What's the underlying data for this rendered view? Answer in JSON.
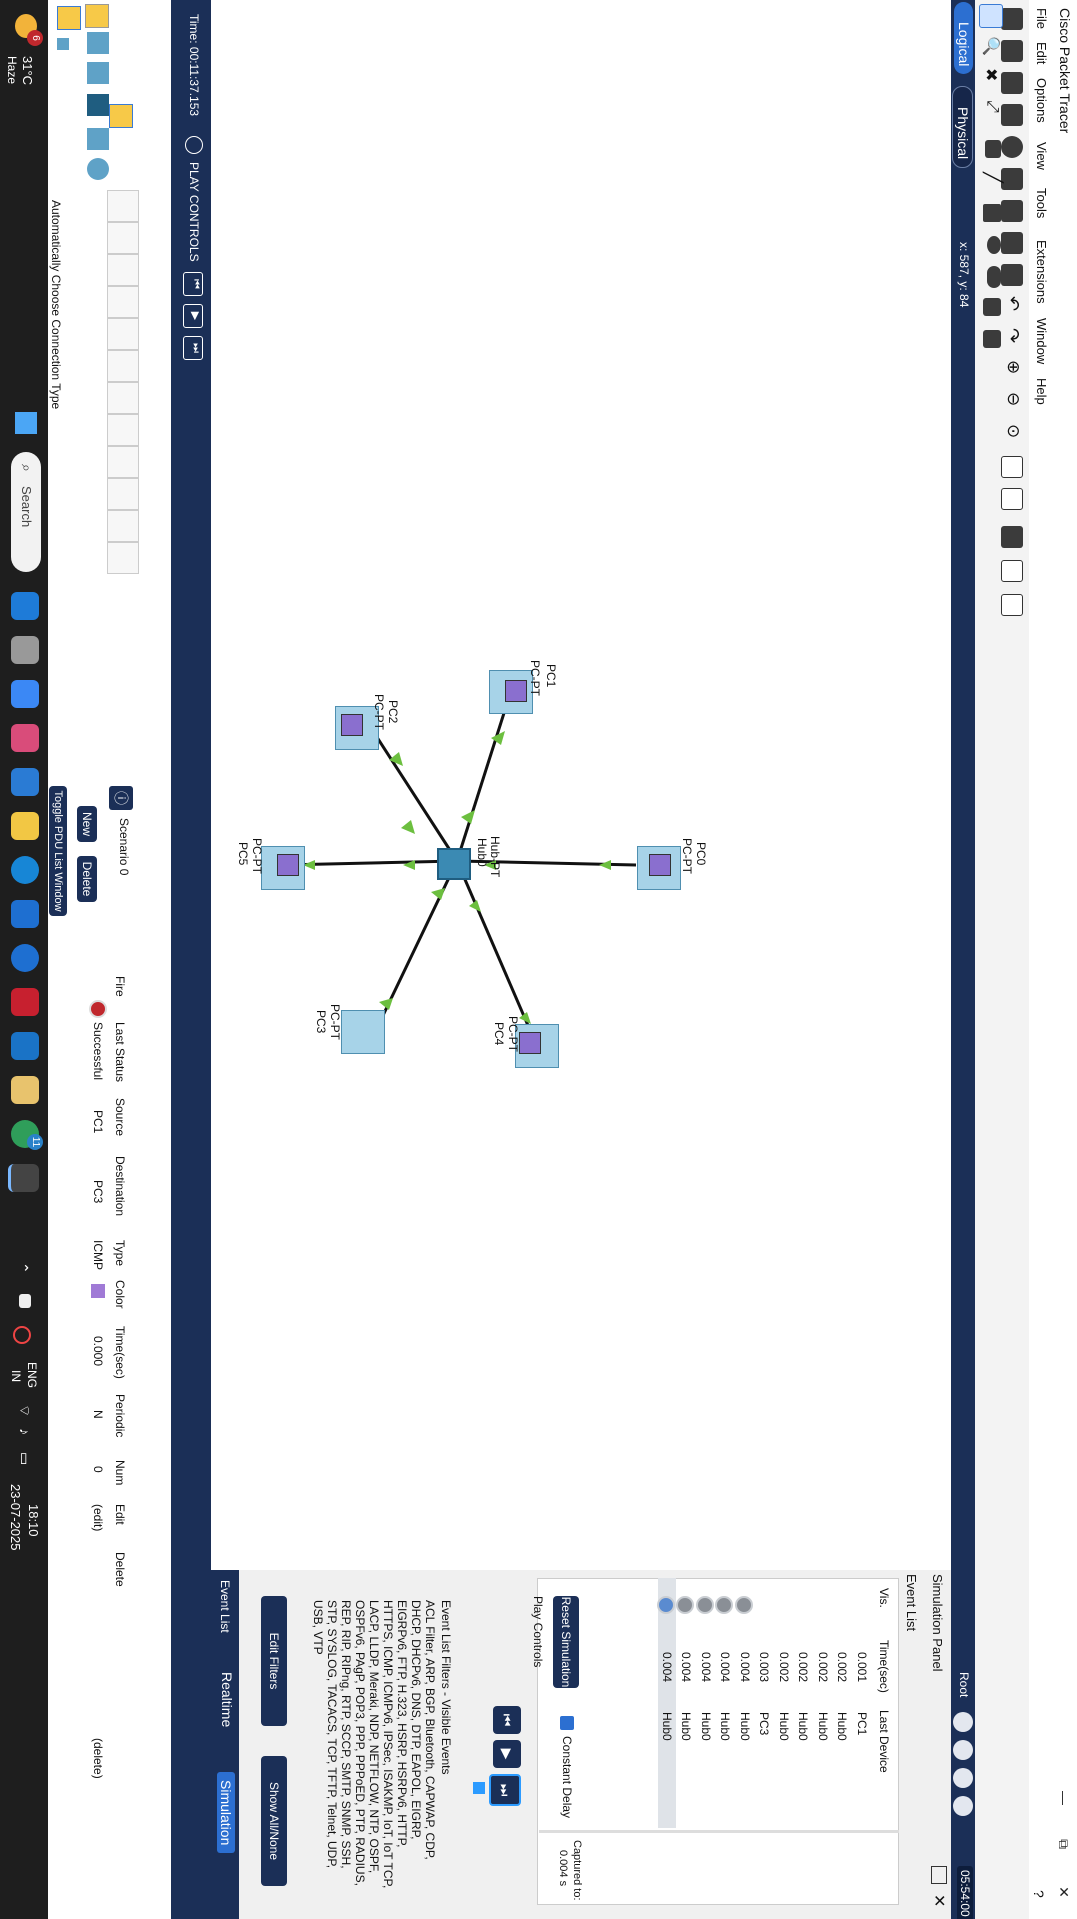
{
  "window": {
    "title": "Cisco Packet Tracer",
    "controls": [
      "—",
      "⧉",
      "✕"
    ],
    "help": "?"
  },
  "menu": [
    "File",
    "Edit",
    "Options",
    "View",
    "Tools",
    "Extensions",
    "Window",
    "Help"
  ],
  "nav": {
    "logical": "Logical",
    "physical": "Physical",
    "coords": "x: 587, y: 84",
    "root": "Root",
    "clock": "05:54:00"
  },
  "devices": [
    {
      "type": "PC-PT",
      "name": "PC0"
    },
    {
      "type": "PC-PT",
      "name": "PC1"
    },
    {
      "type": "PC-PT",
      "name": "PC2"
    },
    {
      "type": "PC-PT",
      "name": "PC3"
    },
    {
      "type": "PC-PT",
      "name": "PC4"
    },
    {
      "type": "PC-PT",
      "name": "PC5"
    },
    {
      "type": "Hub-PT",
      "name": "Hub0"
    }
  ],
  "simulation": {
    "panel_title": "Simulation Panel",
    "event_list_title": "Event List",
    "columns": [
      "Vis.",
      "Time(sec)",
      "Last Device"
    ],
    "events": [
      {
        "time": "0.001",
        "last": "PC1",
        "vis": false
      },
      {
        "time": "0.002",
        "last": "Hub0",
        "vis": false
      },
      {
        "time": "0.002",
        "last": "Hub0",
        "vis": false
      },
      {
        "time": "0.002",
        "last": "Hub0",
        "vis": false
      },
      {
        "time": "0.002",
        "last": "Hub0",
        "vis": false
      },
      {
        "time": "0.003",
        "last": "PC3",
        "vis": false
      },
      {
        "time": "0.004",
        "last": "Hub0",
        "vis": true
      },
      {
        "time": "0.004",
        "last": "Hub0",
        "vis": true
      },
      {
        "time": "0.004",
        "last": "Hub0",
        "vis": true
      },
      {
        "time": "0.004",
        "last": "Hub0",
        "vis": true
      },
      {
        "time": "0.004",
        "last": "Hub0",
        "vis": true
      }
    ],
    "reset": "Reset Simulation",
    "constant_delay": "Constant Delay",
    "captured_label": "Captured to:",
    "captured_value": "0.004 s",
    "play_controls": "Play Controls",
    "filters_title": "Event List Filters - Visible Events",
    "filters_text": "ACL Filter, ARP, BGP, Bluetooth, CAPWAP, CDP, DHCP, DHCPv6, DNS, DTP, EAPOL, EIGRP, EIGRPv6, FTP, H.323, HSRP, HSRPv6, HTTP, HTTPS, ICMP, ICMPv6, IPSec, ISAKMP, IoT, IoT TCP, LACP, LLDP, Meraki, NDP, NETFLOW, NTP, OSPF, OSPFv6, PAgP, POP3, PPP, PPPoED, PTP, RADIUS, REP, RIP, RIPng, RTP, SCCP, SMTP, SNMP, SSH, STP, SYSLOG, TACACS, TCP, TFTP, Telnet, UDP, USB, VTP",
    "edit_filters": "Edit Filters",
    "show_all": "Show All/None",
    "tab_event_list": "Event List",
    "tab_realtime": "Realtime",
    "tab_simulation": "Simulation"
  },
  "play_bar": {
    "time": "Time: 00:11:37.153",
    "play_controls": "PLAY CONTROLS"
  },
  "bottom": {
    "connection_hint": "Automatically Choose Connection Type",
    "scenario": "Scenario 0",
    "new": "New",
    "delete": "Delete",
    "toggle_pdu": "Toggle PDU List Window",
    "pdu_headers": [
      "Fire",
      "Last Status",
      "Source",
      "Destination",
      "Type",
      "Color",
      "Time(sec)",
      "Periodic",
      "Num",
      "Edit",
      "Delete"
    ],
    "pdu_row": {
      "status": "Successful",
      "source": "PC1",
      "destination": "PC3",
      "type": "ICMP",
      "color": "#a07ad6",
      "time": "0.000",
      "periodic": "N",
      "num": "0",
      "edit": "(edit)",
      "delete": "(delete)"
    }
  },
  "taskbar": {
    "weather_temp": "31°C",
    "weather_desc": "Haze",
    "weather_badge": "6",
    "search": "Search",
    "lang1": "ENG",
    "lang2": "IN",
    "time": "18:10",
    "date": "23-07-2025",
    "teams_badge": "11"
  }
}
